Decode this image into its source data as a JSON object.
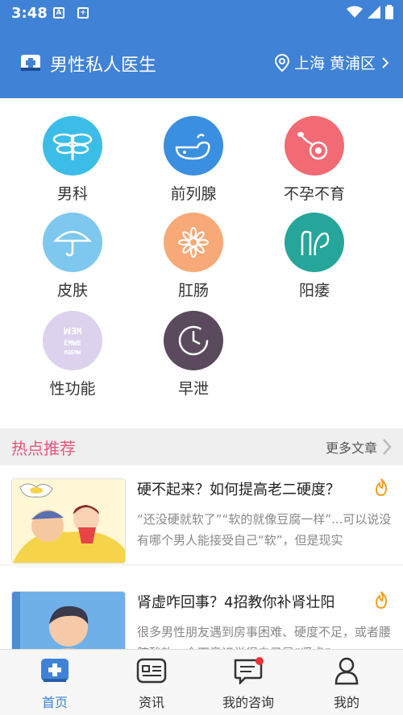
{
  "status_bar": {
    "time": "3:48",
    "icons": [
      "a-notification-icon",
      "plus-notification-icon",
      "wifi-icon",
      "signal-icon",
      "battery-icon"
    ]
  },
  "header": {
    "title": "男性私人医生",
    "location": "上海 黄浦区",
    "colors": {
      "bg": "#3f82d6"
    }
  },
  "categories": [
    {
      "label": "男科",
      "icon": "dragonfly-icon",
      "color": "#3bbde8"
    },
    {
      "label": "前列腺",
      "icon": "whale-icon",
      "color": "#3a8fe0"
    },
    {
      "label": "不孕不育",
      "icon": "sperm-icon",
      "color": "#f26a73"
    },
    {
      "label": "皮肤",
      "icon": "umbrella-icon",
      "color": "#7ec8ef"
    },
    {
      "label": "肛肠",
      "icon": "flower-icon",
      "color": "#f7a977"
    },
    {
      "label": "阳痿",
      "icon": "abstract-shape-icon",
      "color": "#26a69a"
    },
    {
      "label": "性功能",
      "icon": "eye-chart-icon",
      "color": "#dcd2ee"
    },
    {
      "label": "早泄",
      "icon": "clock-icon",
      "color": "#5b4a5d"
    }
  ],
  "hot": {
    "title": "热点推荐",
    "more": "更多文章"
  },
  "articles": [
    {
      "title": "硬不起来？如何提高老二硬度？",
      "summary": "“还没硬就软了”“软的就像豆腐一样”...可以说没有哪个男人能接受自己“软”，但是现实"
    },
    {
      "title": "肾虚咋回事？4招教你补肾壮阳",
      "summary": "很多男性朋友遇到房事困难、硬度不足，或者腰膝酸软、全下意识觉得自己是“肾虚”"
    }
  ],
  "tabs": [
    {
      "label": "首页",
      "icon": "home-plus-icon",
      "active": true
    },
    {
      "label": "资讯",
      "icon": "news-icon",
      "active": false
    },
    {
      "label": "我的咨询",
      "icon": "chat-icon",
      "active": false,
      "badge": true
    },
    {
      "label": "我的",
      "icon": "user-icon",
      "active": false
    }
  ]
}
